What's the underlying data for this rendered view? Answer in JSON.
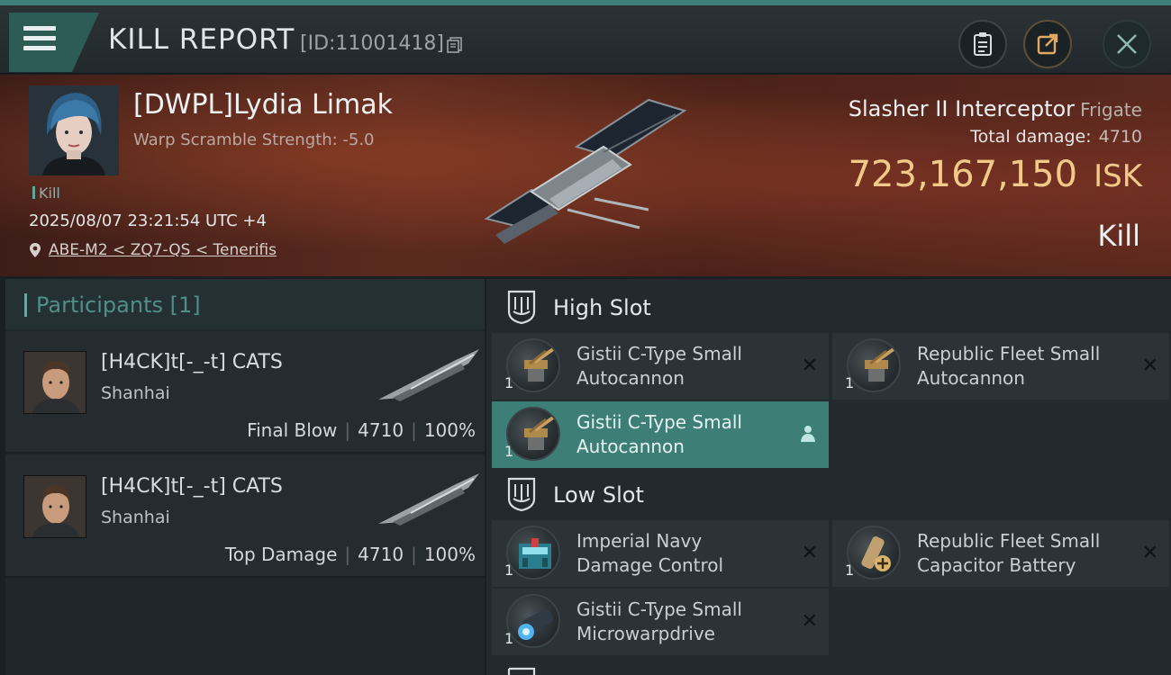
{
  "header": {
    "title": "KILL REPORT",
    "id_label": "[ID:11001418]"
  },
  "victim": {
    "name": "[DWPL]Lydia Limak",
    "scramble": "Warp Scramble Strength: -5.0",
    "tag": "Kill",
    "datetime": "2025/08/07 23:21:54 UTC +4",
    "location": "ABE-M2 < ZQ7-QS < Tenerifis",
    "ship_name": "Slasher II Interceptor",
    "ship_class": "Frigate",
    "total_damage_label": "Total damage:",
    "total_damage_value": "4710",
    "isk_value": "723,167,150",
    "isk_unit": "ISK",
    "result": "Kill"
  },
  "participants": {
    "title": "Participants",
    "count": "[1]",
    "rows": [
      {
        "name": "[H4CK]t[-_-t] CATS",
        "corp": "Shanhai",
        "role": "Final Blow",
        "damage": "4710",
        "percent": "100%"
      },
      {
        "name": "[H4CK]t[-_-t] CATS",
        "corp": "Shanhai",
        "role": "Top Damage",
        "damage": "4710",
        "percent": "100%"
      }
    ]
  },
  "fitting": {
    "high_slot": {
      "title": "High Slot",
      "modules": [
        {
          "name_line1": "Gistii C-Type Small",
          "name_line2": "Autocannon",
          "qty": "1",
          "icon": "autocannon-icon"
        },
        {
          "name_line1": "Republic Fleet Small",
          "name_line2": "Autocannon",
          "qty": "1",
          "icon": "autocannon-icon"
        },
        {
          "name_line1": "Gistii C-Type Small",
          "name_line2": "Autocannon",
          "qty": "1",
          "icon": "autocannon-icon"
        }
      ]
    },
    "low_slot": {
      "title": "Low Slot",
      "modules": [
        {
          "name_line1": "Imperial Navy",
          "name_line2": "Damage Control",
          "qty": "1",
          "icon": "damage-control-icon"
        },
        {
          "name_line1": "Republic Fleet Small",
          "name_line2": "Capacitor Battery",
          "qty": "1",
          "icon": "capacitor-battery-icon"
        },
        {
          "name_line1": "Gistii C-Type Small",
          "name_line2": "Microwarpdrive",
          "qty": "1",
          "icon": "microwarpdrive-icon"
        }
      ]
    }
  },
  "colors": {
    "accent_teal": "#3d7f77",
    "isk_gold": "#f3c98a",
    "banner_red": "#5b2a1f"
  }
}
